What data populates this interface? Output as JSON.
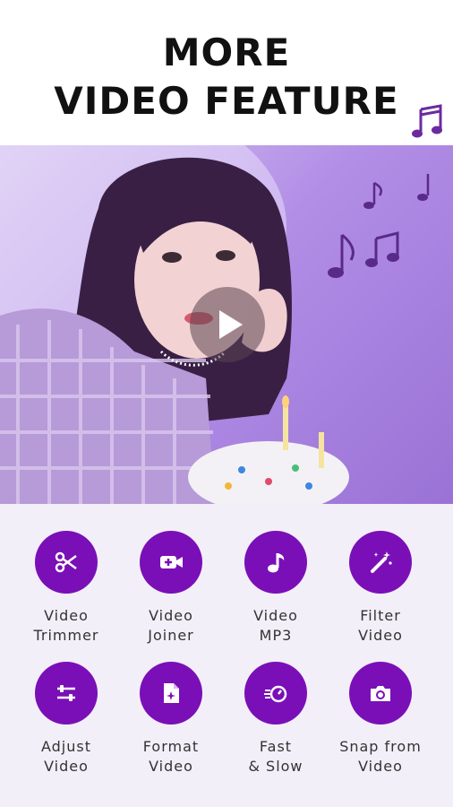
{
  "header": {
    "title_line1": "MORE",
    "title_line2": "VIDEO FEATURE",
    "decoration_icon": "music-notes-icon"
  },
  "hero": {
    "play_icon": "play-icon",
    "accent_color": "#5a2a8a"
  },
  "features": [
    {
      "line1": "Video",
      "line2": "Trimmer",
      "icon": "scissors-icon"
    },
    {
      "line1": "Video",
      "line2": "Joiner",
      "icon": "video-add-icon"
    },
    {
      "line1": "Video",
      "line2": "MP3",
      "icon": "music-note-icon"
    },
    {
      "line1": "Filter",
      "line2": "Video",
      "icon": "magic-wand-icon"
    },
    {
      "line1": "Adjust",
      "line2": "Video",
      "icon": "sliders-icon"
    },
    {
      "line1": "Format",
      "line2": "Video",
      "icon": "file-sparkle-icon"
    },
    {
      "line1": "Fast",
      "line2": "& Slow",
      "icon": "speed-icon"
    },
    {
      "line1": "Snap from",
      "line2": "Video",
      "icon": "camera-icon"
    }
  ],
  "colors": {
    "primary": "#7a0fb7",
    "panel_bg": "#f3eff9"
  }
}
